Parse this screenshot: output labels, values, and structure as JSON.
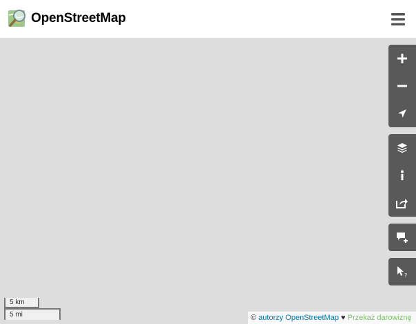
{
  "header": {
    "brand": "OpenStreetMap",
    "logo_icon": "osm-magnifier-logo",
    "menu_icon": "hamburger-menu-icon"
  },
  "map": {
    "background_color": "#dddddd",
    "controls": {
      "group_color": "#595959",
      "navigation": [
        {
          "icon": "zoom-in-icon"
        },
        {
          "icon": "zoom-out-icon"
        },
        {
          "icon": "locate-arrow-icon"
        }
      ],
      "panels": [
        {
          "icon": "layers-icon"
        },
        {
          "icon": "info-icon"
        },
        {
          "icon": "share-icon"
        }
      ],
      "note": {
        "icon": "add-note-icon"
      },
      "query": {
        "icon": "query-features-icon"
      }
    },
    "scale": {
      "metric": "5 km",
      "imperial": "5 mi"
    },
    "attribution": {
      "copyright": "©",
      "contributors_link": "autorzy OpenStreetMap",
      "heart": "♥",
      "donate_link": "Przekaż darowiznę"
    }
  }
}
